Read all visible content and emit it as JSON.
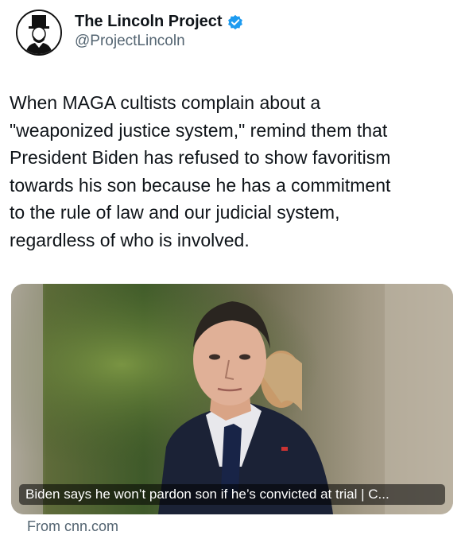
{
  "profile": {
    "display_name": "The Lincoln Project",
    "handle": "@ProjectLincoln",
    "verified_color": "#1d9bf0"
  },
  "tweet": {
    "lines": [
      "When MAGA cultists complain about a",
      "\"weaponized justice system,\" remind them that",
      "President Biden has refused to show favoritism",
      "towards his son because he has a commitment",
      "to the rule of law and our judicial system,",
      "regardless of who is involved."
    ]
  },
  "card": {
    "headline": "Biden says he won’t pardon son if he’s convicted at trial | C...",
    "source": "From cnn.com"
  }
}
